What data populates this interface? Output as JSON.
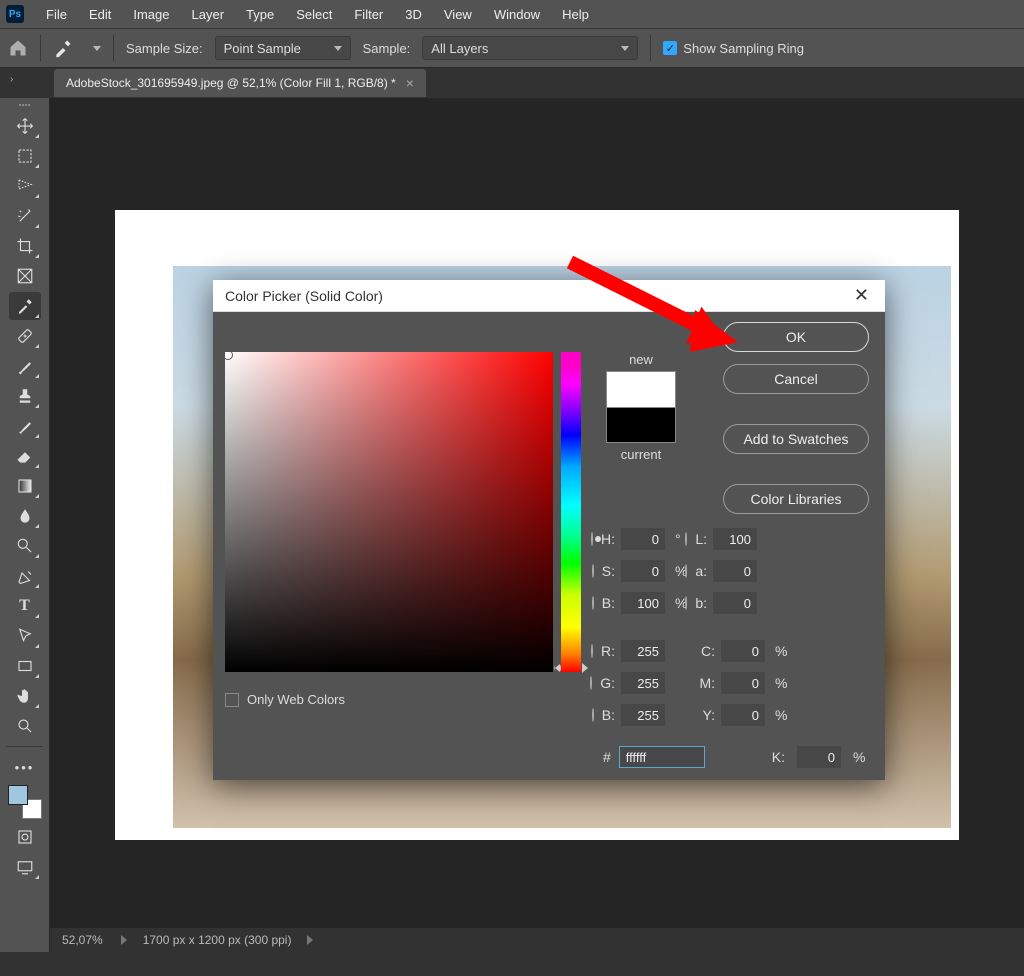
{
  "menu": {
    "items": [
      "File",
      "Edit",
      "Image",
      "Layer",
      "Type",
      "Select",
      "Filter",
      "3D",
      "View",
      "Window",
      "Help"
    ]
  },
  "options": {
    "sample_size_label": "Sample Size:",
    "sample_size_value": "Point Sample",
    "sample_label": "Sample:",
    "sample_value": "All Layers",
    "show_ring": "Show Sampling Ring"
  },
  "tab": {
    "title": "AdobeStock_301695949.jpeg @ 52,1% (Color Fill 1, RGB/8) *"
  },
  "status": {
    "zoom": "52,07%",
    "dims": "1700 px x 1200 px (300 ppi)"
  },
  "cp": {
    "title": "Color Picker (Solid Color)",
    "ok": "OK",
    "cancel": "Cancel",
    "swatches": "Add to Swatches",
    "libs": "Color Libraries",
    "new": "new",
    "current": "current",
    "owc": "Only Web Colors",
    "H": "H:",
    "S": "S:",
    "B": "B:",
    "L": "L:",
    "a": "a:",
    "b": "b:",
    "R": "R:",
    "G": "G:",
    "Bl": "B:",
    "C": "C:",
    "M": "M:",
    "Y": "Y:",
    "K": "K:",
    "deg": "°",
    "pct": "%",
    "hash": "#",
    "vals": {
      "H": "0",
      "S": "0",
      "B": "100",
      "L": "100",
      "a": "0",
      "b": "0",
      "R": "255",
      "G": "255",
      "Bl": "255",
      "C": "0",
      "M": "0",
      "Y": "0",
      "K": "0",
      "hex": "ffffff"
    }
  },
  "colors": {
    "accent": "#31a8ff"
  }
}
